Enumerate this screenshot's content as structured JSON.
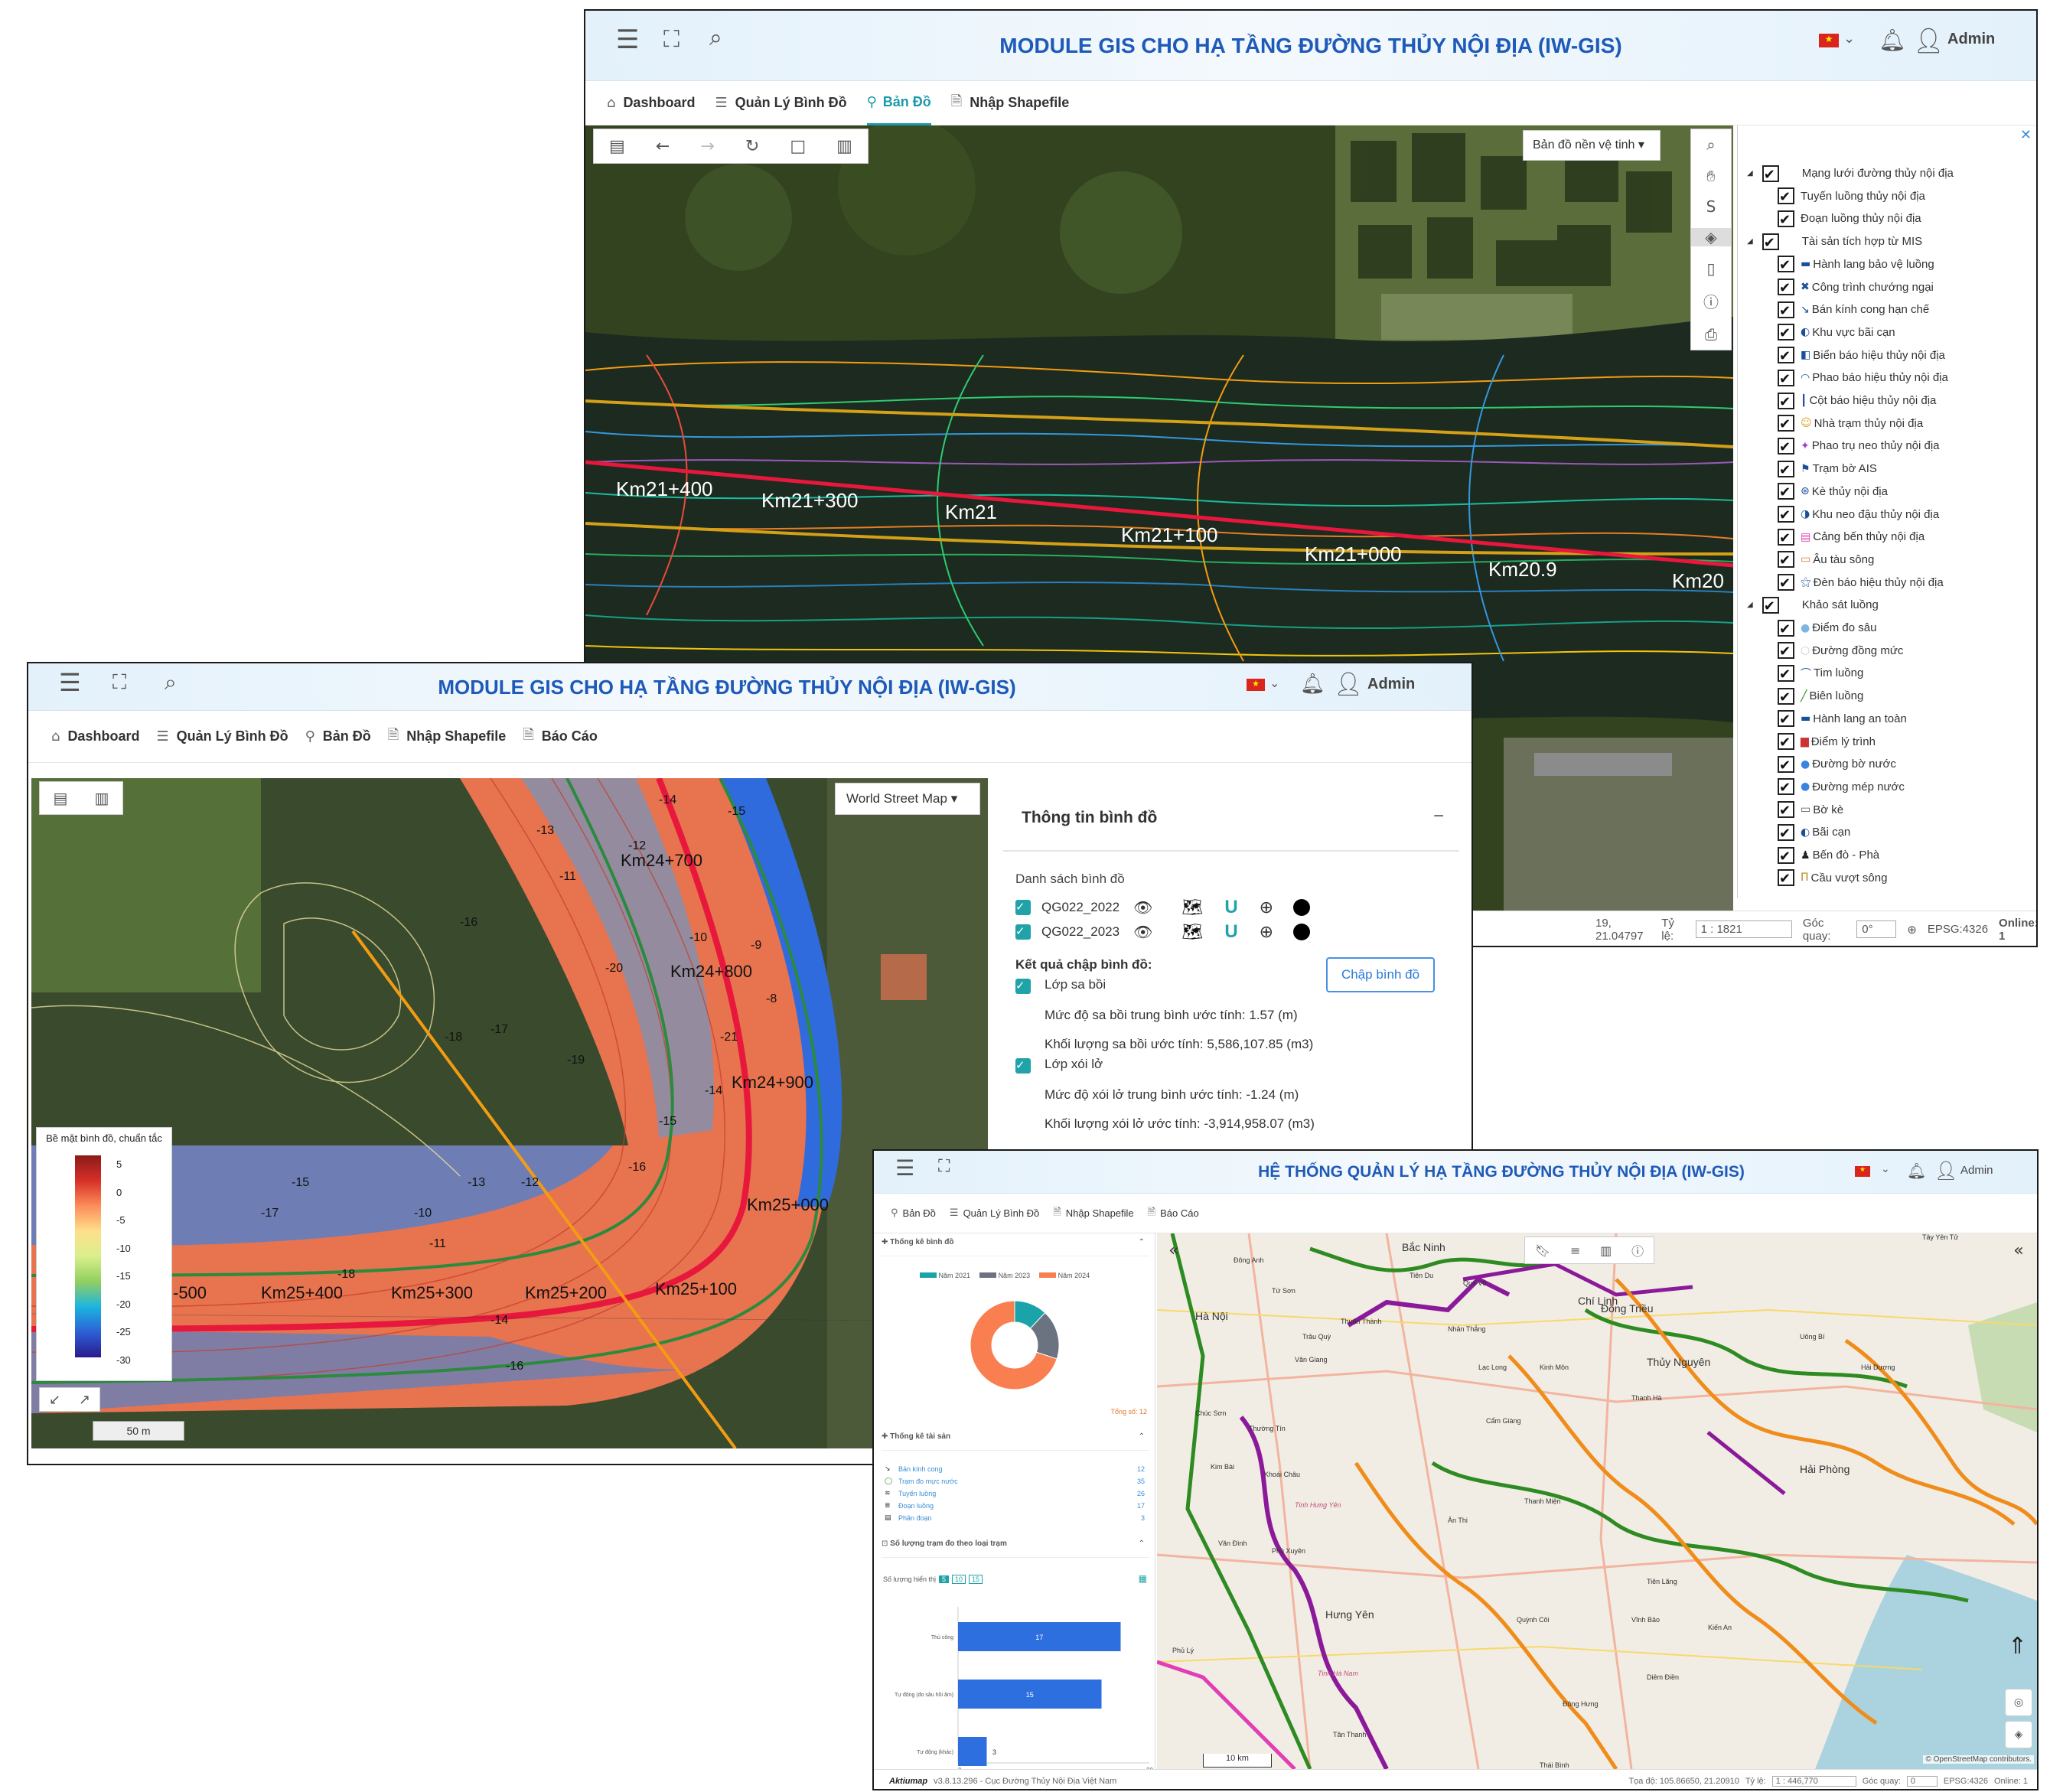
{
  "top": {
    "title": "MODULE GIS CHO HẠ TẦNG ĐƯỜNG THỦY NỘI ĐỊA (IW-GIS)",
    "user": "Admin",
    "nav": [
      "Dashboard",
      "Quản Lý Bình Đồ",
      "Bản Đồ",
      "Nhập Shapefile"
    ],
    "basemap": "Bản đồ nền vệ tinh",
    "km_labels": [
      "Km21+400",
      "Km21+300",
      "Km21",
      "Km21+100",
      "Km21+000",
      "Km20.9",
      "Km20"
    ],
    "layers": [
      {
        "label": "Mạng lưới đường thủy nội địa",
        "group": true
      },
      {
        "label": "Tuyến luồng thủy nội địa"
      },
      {
        "label": "Đoạn luồng thủy nội địa"
      },
      {
        "label": "Tài sản tích hợp từ MIS",
        "group": true
      },
      {
        "label": "Hành lang bảo vệ luồng"
      },
      {
        "label": "Công trình chướng ngại"
      },
      {
        "label": "Bán kính cong hạn chế"
      },
      {
        "label": "Khu vực bãi cạn"
      },
      {
        "label": "Biển báo hiệu thủy nội địa"
      },
      {
        "label": "Phao báo hiệu thủy nội địa"
      },
      {
        "label": "Cột báo hiệu thủy nội địa"
      },
      {
        "label": "Nhà trạm thủy nội địa"
      },
      {
        "label": "Phao trụ neo thủy nội địa"
      },
      {
        "label": "Trạm bờ AIS"
      },
      {
        "label": "Kè thủy nội địa"
      },
      {
        "label": "Khu neo đậu thủy nội địa"
      },
      {
        "label": "Cảng bến thủy nội địa"
      },
      {
        "label": "Âu tàu sông"
      },
      {
        "label": "Đèn báo hiệu thủy nội địa"
      },
      {
        "label": "Khảo sát luồng",
        "group": true
      },
      {
        "label": "Điểm đo sâu"
      },
      {
        "label": "Đường đồng mức"
      },
      {
        "label": "Tim luồng"
      },
      {
        "label": "Biên luồng"
      },
      {
        "label": "Hành lang an toàn"
      },
      {
        "label": "Điểm lý trình"
      },
      {
        "label": "Đường bờ nước"
      },
      {
        "label": "Đường mép nước"
      },
      {
        "label": "Bờ kè"
      },
      {
        "label": "Bãi cạn"
      },
      {
        "label": "Bến đò - Phà"
      },
      {
        "label": "Cầu vượt sông"
      }
    ],
    "status": {
      "coords": "19, 21.04797",
      "scale_label": "Tỷ lệ:",
      "scale_prefix": "1 :",
      "scale_value": "1821",
      "angle_label": "Góc quay:",
      "angle_value": "0°",
      "epsg": "EPSG:4326",
      "online": "Online: 1"
    }
  },
  "mid": {
    "title": "MODULE GIS CHO HẠ TẦNG ĐƯỜNG THỦY NỘI ĐỊA (IW-GIS)",
    "user": "Admin",
    "nav": [
      "Dashboard",
      "Quản Lý Bình Đồ",
      "Bản Đồ",
      "Nhập Shapefile",
      "Báo Cáo"
    ],
    "basemap": "World Street Map",
    "legend_title": "Bề mặt bình đồ, chuẩn tắc",
    "legend_ticks": [
      "5",
      "0",
      "-5",
      "-10",
      "-15",
      "-20",
      "-25",
      "-30"
    ],
    "scale_bar": "50 m",
    "km_labels": [
      "Km24+700",
      "Km24+800",
      "Km24+900",
      "Km25+000",
      "Km25+100",
      "Km25+200",
      "Km25+300",
      "Km25+400",
      "-500"
    ],
    "depths": [
      "-14",
      "-15",
      "-13",
      "-12",
      "-11",
      "-16",
      "-17",
      "-18",
      "-19",
      "-20",
      "-10",
      "-9",
      "-8",
      "-21",
      "-14",
      "-15",
      "-16",
      "-12",
      "-13",
      "-10",
      "-11",
      "-15",
      "-17",
      "-18",
      "-14",
      "-16"
    ],
    "panel": {
      "title": "Thông tin bình đồ",
      "list_label": "Danh sách bình đồ",
      "items": [
        "QG022_2022",
        "QG022_2023"
      ],
      "result_label": "Kết quả chập bình đồ:",
      "button": "Chập bình đồ",
      "layer1": "Lớp sa bồi",
      "line1a": "Mức độ sa bồi trung bình ước tính: 1.57 (m)",
      "line1b": "Khối lượng sa bồi ước tính: 5,586,107.85 (m3)",
      "layer2": "Lớp xói lở",
      "line2a": "Mức độ xói lở trung bình ước tính: -1.24 (m)",
      "line2b": "Khối lượng xói lở ước tính: -3,914,958.07 (m3)"
    }
  },
  "bot": {
    "title": "HỆ THỐNG QUẢN LÝ HẠ TẦNG ĐƯỜNG THỦY NỘI ĐỊA (IW-GIS)",
    "user": "Admin",
    "nav": [
      "Bản Đồ",
      "Quản Lý Bình Đồ",
      "Nhập Shapefile",
      "Báo Cáo"
    ],
    "sec1": "Thống kê bình đồ",
    "legend": [
      "Năm 2021",
      "Năm 2023",
      "Năm 2024"
    ],
    "colors": [
      "#1aa3a8",
      "#6b7280",
      "#f97f51"
    ],
    "pie": [
      12,
      18,
      70
    ],
    "total": "Tổng số: 12",
    "sec2": "Thống kê tài sản",
    "assets": [
      {
        "label": "Bán kính cong",
        "value": "12"
      },
      {
        "label": "Trạm đo mực nước",
        "value": "35"
      },
      {
        "label": "Tuyến luồng",
        "value": "26"
      },
      {
        "label": "Đoạn luồng",
        "value": "17"
      },
      {
        "label": "Phân đoạn",
        "value": "3"
      }
    ],
    "sec3": "Số lượng trạm đo theo loại trạm",
    "show_label": "Số lượng hiển thị",
    "show_opts": [
      "5",
      "10",
      "15"
    ],
    "bars": [
      {
        "label": "Thủ công",
        "value": 17
      },
      {
        "label": "Tự động (đo sâu hồi âm)",
        "value": 15
      },
      {
        "label": "Tự động (khác)",
        "value": 3
      }
    ],
    "bar_axis": [
      "0",
      "20"
    ],
    "places": [
      "Bắc Ninh",
      "Tiên Du",
      "Quế Võ",
      "Chí Linh",
      "Đông Triều",
      "Uông Bí",
      "Tây Yên Tử",
      "Hà Nội",
      "Tứ Sơn",
      "Đông Anh",
      "Thuận Thành",
      "Nhân Thắng",
      "Trâu Quỳ",
      "Văn Giang",
      "Lạc Long",
      "Cẩm Giàng",
      "Kinh Môn",
      "Thủy Nguyên",
      "Hải Dương",
      "Hải Phòng",
      "Thanh Hà",
      "Chúc Sơn",
      "Thường Tín",
      "Kim Bài",
      "Khoái Châu",
      "Tinh Hưng Yên",
      "Ân Thi",
      "Thanh Miện",
      "Phù Xuyên",
      "Văn Đình",
      "Hưng Yên",
      "Tiên Lãng",
      "Vĩnh Bảo",
      "Quỳnh Côi",
      "Kiến An",
      "Phủ Lý",
      "Đông Hưng",
      "Tinh Hà Nam",
      "Diêm Điền",
      "Tân Thanh",
      "Thái Bình"
    ],
    "map_attr": "© OpenStreetMap contributors.",
    "scale_bar": "10 km",
    "footer_left": "Aktiumap",
    "footer_ver": "v3.8.13.296 - Cục Đường Thủy Nội Địa Việt Nam",
    "coords": "Tọa độ: 105.86650, 21.20910",
    "scale_label": "Tỷ lệ:",
    "scale_prefix": "1 :",
    "scale_value": "446,770",
    "angle_label": "Góc quay:",
    "angle_value": "0",
    "epsg": "EPSG:4326",
    "online": "Online: 1"
  }
}
